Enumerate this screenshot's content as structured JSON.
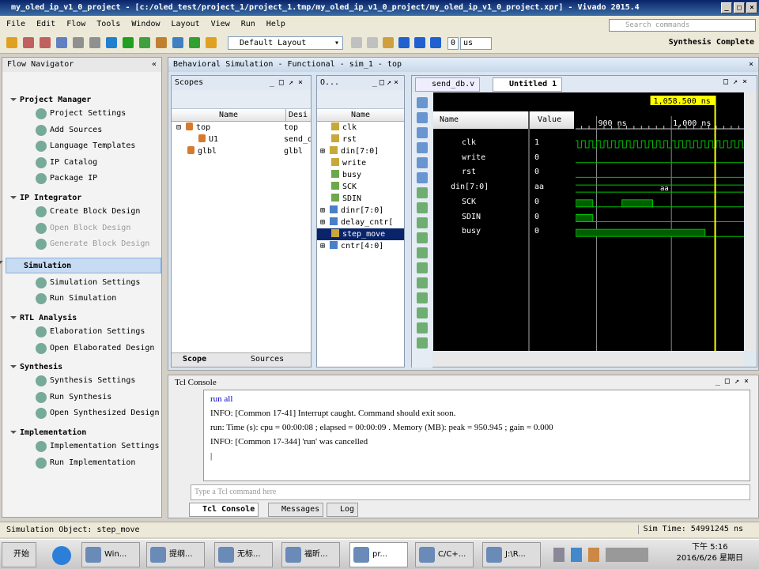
{
  "window": {
    "title": "my_oled_ip_v1_0_project - [c:/oled_test/project_1/project_1.tmp/my_oled_ip_v1_0_project/my_oled_ip_v1_0_project.xpr] - Vivado 2015.4"
  },
  "menu": [
    "File",
    "Edit",
    "Flow",
    "Tools",
    "Window",
    "Layout",
    "View",
    "Run",
    "Help"
  ],
  "search": {
    "placeholder": "Search commands"
  },
  "toolbar": {
    "layout": "Default Layout",
    "run_time": "0",
    "run_unit": "us",
    "status": "Synthesis Complete"
  },
  "flow_navigator": {
    "title": "Flow Navigator",
    "sections": [
      {
        "label": "Project Manager",
        "items": [
          {
            "label": "Project Settings"
          },
          {
            "label": "Add Sources"
          },
          {
            "label": "Language Templates"
          },
          {
            "label": "IP Catalog"
          },
          {
            "label": "Package IP"
          }
        ]
      },
      {
        "label": "IP Integrator",
        "items": [
          {
            "label": "Create Block Design"
          },
          {
            "label": "Open Block Design",
            "disabled": true
          },
          {
            "label": "Generate Block Design",
            "disabled": true
          }
        ]
      },
      {
        "label": "Simulation",
        "selected": true,
        "items": [
          {
            "label": "Simulation Settings"
          },
          {
            "label": "Run Simulation"
          }
        ]
      },
      {
        "label": "RTL Analysis",
        "items": [
          {
            "label": "Elaboration Settings"
          },
          {
            "label": "Open Elaborated Design"
          }
        ]
      },
      {
        "label": "Synthesis",
        "items": [
          {
            "label": "Synthesis Settings"
          },
          {
            "label": "Run Synthesis"
          },
          {
            "label": "Open Synthesized Design"
          }
        ]
      },
      {
        "label": "Implementation",
        "items": [
          {
            "label": "Implementation Settings"
          },
          {
            "label": "Run Implementation"
          }
        ]
      }
    ]
  },
  "main": {
    "header": "Behavioral Simulation - Functional - sim_1 - top"
  },
  "scopes": {
    "title": "Scopes",
    "columns": [
      "Name",
      "Desi"
    ],
    "rows": [
      [
        "top",
        "top"
      ],
      [
        "U1",
        "send_d"
      ],
      [
        "glbl",
        "glbl"
      ]
    ],
    "tabs": [
      "Scope",
      "Sources"
    ]
  },
  "objects": {
    "title": "O...",
    "column": "Name",
    "rows": [
      "clk",
      "rst",
      "din[7:0]",
      "write",
      "busy",
      "SCK",
      "SDIN",
      "dinr[7:0]",
      "delay_cntr[",
      "step_move",
      "cntr[4:0]"
    ],
    "selected": "step_move"
  },
  "wave": {
    "tabs": [
      "send_db.v",
      "Untitled 1"
    ],
    "name_header": "Name",
    "value_header": "Value",
    "cursor": "1,058.500 ns",
    "tick_labels": [
      "900 ns",
      "1,000 ns"
    ],
    "signals": [
      {
        "name": "clk",
        "value": "1"
      },
      {
        "name": "write",
        "value": "0"
      },
      {
        "name": "rst",
        "value": "0"
      },
      {
        "name": "din[7:0]",
        "value": "aa",
        "bus_label": "aa"
      },
      {
        "name": "SCK",
        "value": "0"
      },
      {
        "name": "SDIN",
        "value": "0"
      },
      {
        "name": "busy",
        "value": "0"
      }
    ],
    "color": "#00c000",
    "cursor_color": "#ffff00"
  },
  "chart_data": {
    "type": "waveform",
    "x_unit": "ns",
    "xlim": [
      872,
      1097
    ],
    "cursor": 1058.5,
    "ticks": [
      900,
      1000
    ],
    "series": [
      {
        "name": "clk",
        "clock_period": 10
      },
      {
        "name": "write",
        "edges": [],
        "initial": 0
      },
      {
        "name": "rst",
        "edges": [],
        "initial": 0
      },
      {
        "name": "din[7:0]",
        "bus": "aa"
      },
      {
        "name": "SCK",
        "initial": 1,
        "edges": [
          895,
          934,
          975
        ]
      },
      {
        "name": "SDIN",
        "initial": 1,
        "edges": [
          895
        ]
      },
      {
        "name": "busy",
        "initial": 1,
        "edges": [
          1045
        ]
      }
    ]
  },
  "console": {
    "title": "Tcl Console",
    "lines": [
      "run all",
      "INFO: [Common 17-41] Interrupt caught. Command should exit soon.",
      "run: Time (s): cpu = 00:00:08 ; elapsed = 00:00:09 . Memory (MB): peak = 950.945 ; gain = 0.000",
      "INFO: [Common 17-344] 'run' was cancelled"
    ],
    "placeholder": "Type a Tcl command here",
    "tabs": [
      "Tcl Console",
      "Messages",
      "Log"
    ]
  },
  "status": {
    "object": "Simulation Object: step_move",
    "sim_time": "Sim Time: 54991245 ns"
  },
  "taskbar": {
    "start": "开始",
    "tasks": [
      "Win...",
      "提纲...",
      "无标...",
      "福昕...",
      "pr...",
      "C/C+...",
      "J:\\R..."
    ],
    "time": "下午 5:16",
    "date": "2016/6/26 星期日"
  }
}
